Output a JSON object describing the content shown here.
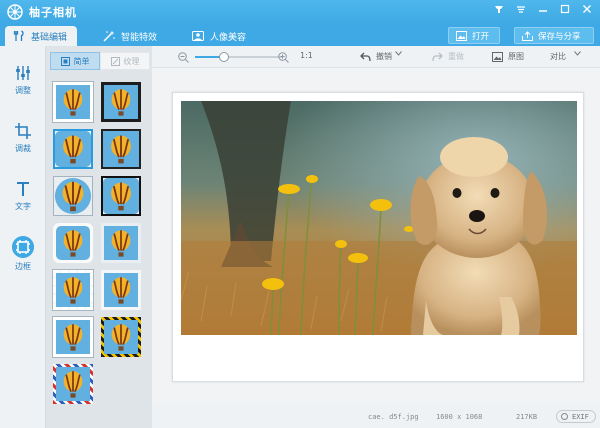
{
  "app": {
    "title": "柚子相机"
  },
  "tabs": [
    {
      "label": "基础编辑",
      "active": true,
      "icon": "tools-icon"
    },
    {
      "label": "智能特效",
      "active": false,
      "icon": "magic-wand-icon"
    },
    {
      "label": "人像美容",
      "active": false,
      "icon": "portrait-icon"
    }
  ],
  "toolbar_right": {
    "open_label": "打开",
    "save_share_label": "保存与分享"
  },
  "left_tools": [
    {
      "label": "调整",
      "icon": "sliders-icon"
    },
    {
      "label": "调裁",
      "icon": "crop-icon"
    },
    {
      "label": "文字",
      "icon": "text-icon"
    },
    {
      "label": "边框",
      "icon": "frame-icon",
      "active": true
    }
  ],
  "frame_panel": {
    "tab_simple": "简单",
    "tab_texture": "纹理"
  },
  "canvas_toolbar": {
    "zoom_ratio": "1:1",
    "undo_label": "撤销",
    "redo_label": "重做",
    "original_label": "原图",
    "compare_label": "对比"
  },
  "status": {
    "filename": "cae. d5f.jpg",
    "dimensions": "1600 x 1068",
    "filesize": "217KB",
    "exif_label": "EXIF"
  },
  "colors": {
    "accent": "#3ea9e4",
    "title_bar": "#4fb7ec",
    "active_text": "#2b7fbf"
  }
}
